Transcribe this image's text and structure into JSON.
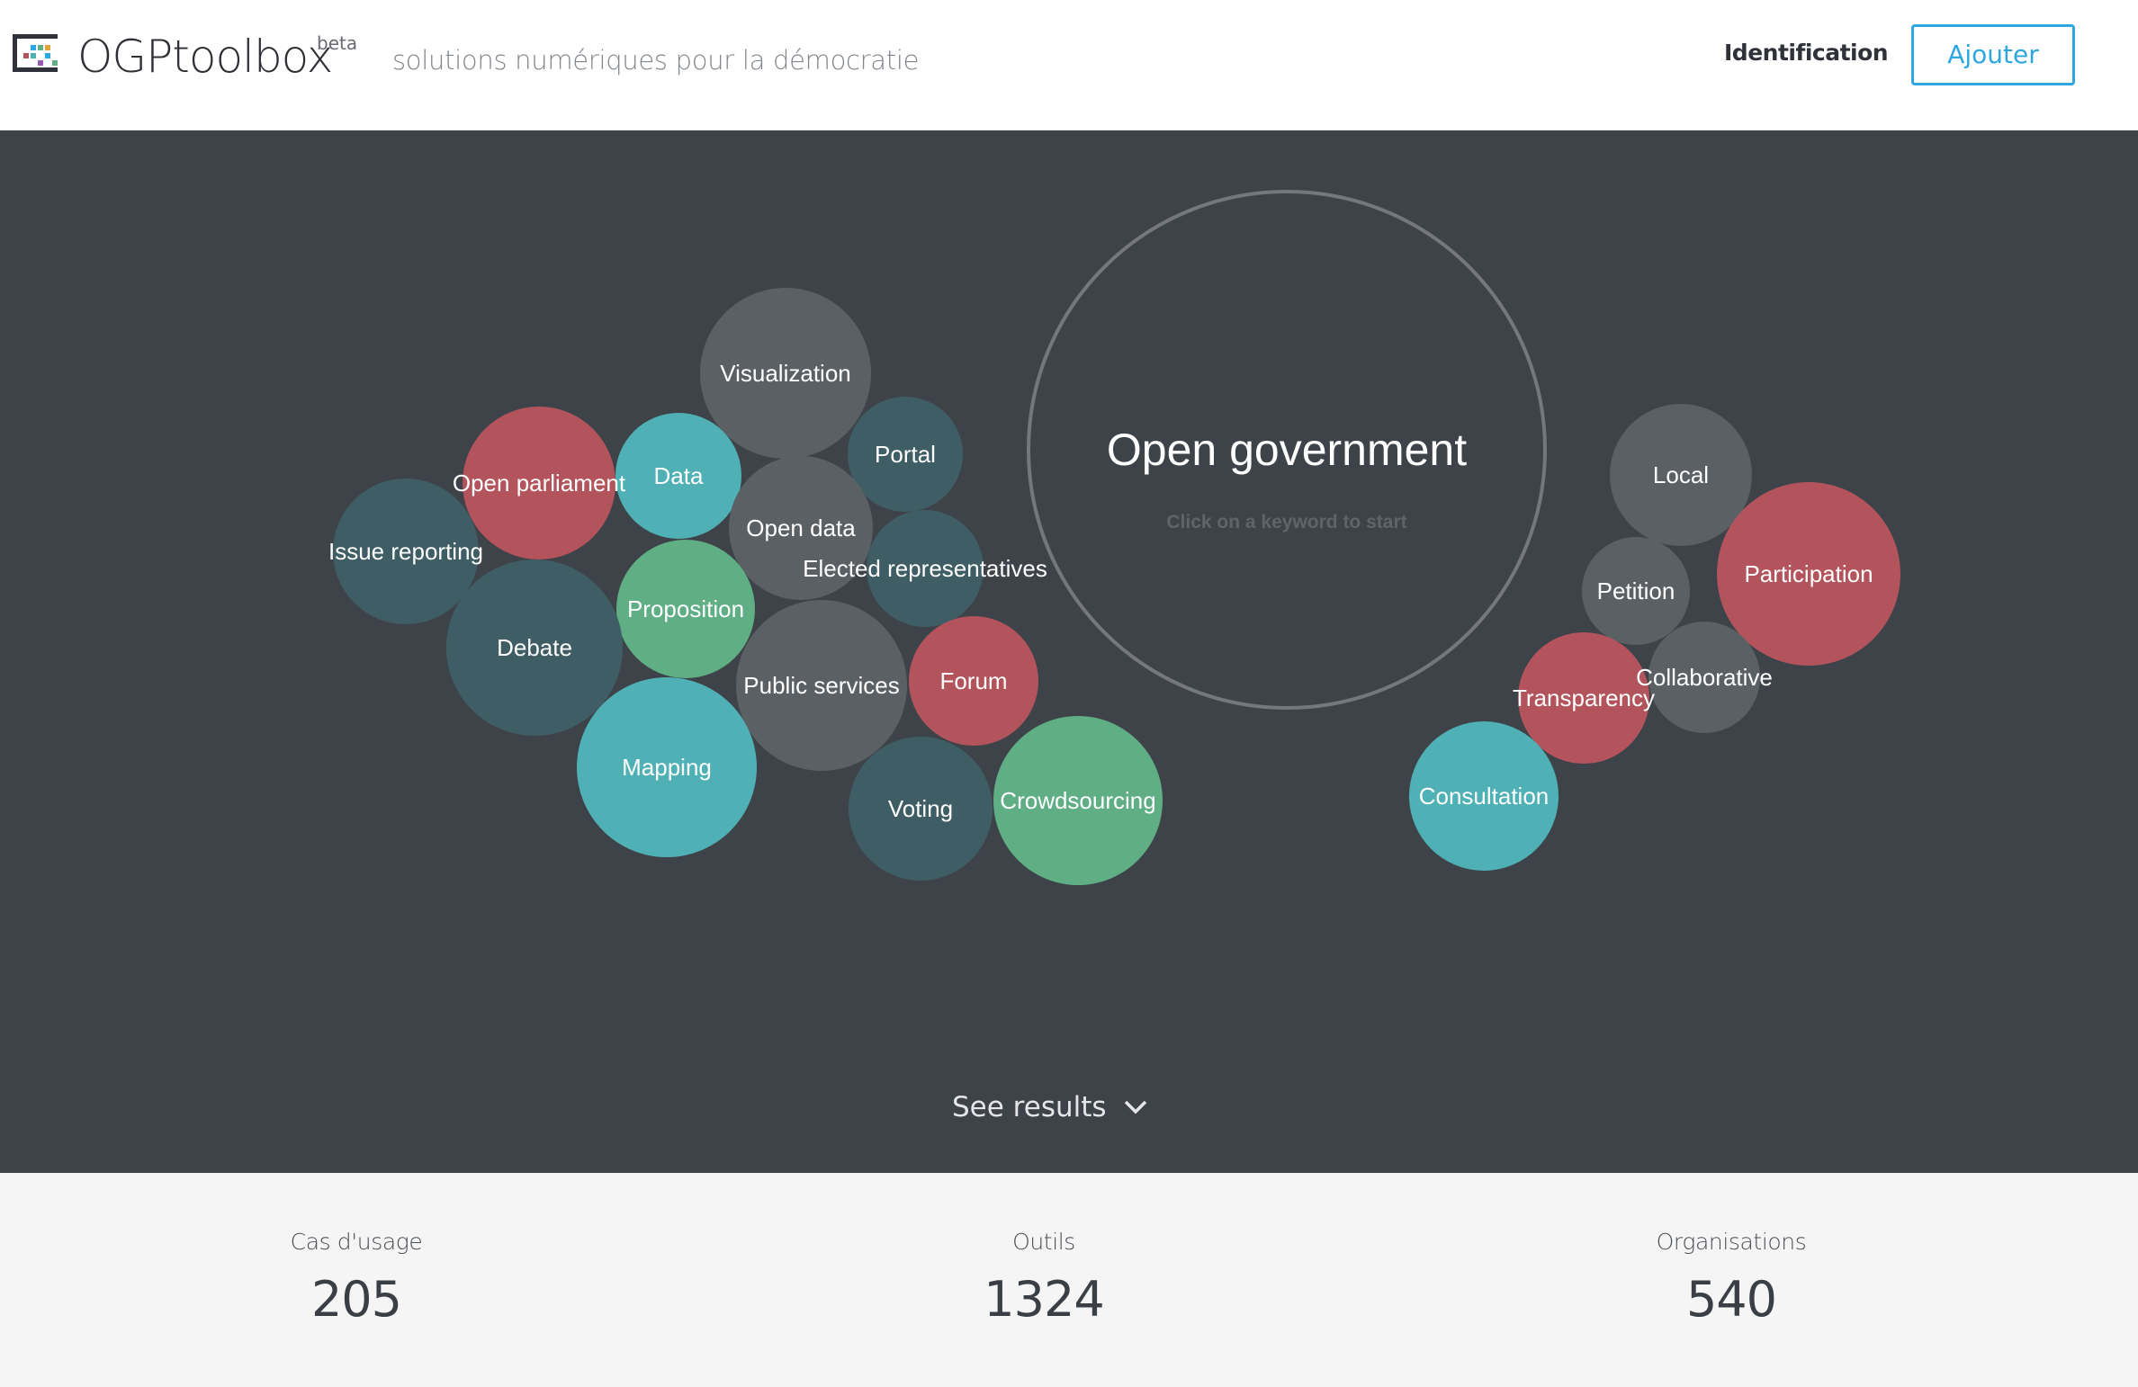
{
  "header": {
    "brand_main": "OGP",
    "brand_tool": "toolbox",
    "beta": "beta",
    "tagline": "solutions numériques pour la démocratie",
    "nav_identification": "Identification",
    "add_button": "Ajouter"
  },
  "hero": {
    "center_title": "Open government",
    "center_hint": "Click on a keyword to start",
    "see_results": "See results",
    "bubbles": [
      {
        "label": "Visualization",
        "color": "#5b6065"
      },
      {
        "label": "Portal",
        "color": "#3f5d64"
      },
      {
        "label": "Open parliament",
        "color": "#b3545c"
      },
      {
        "label": "Data",
        "color": "#4fb1b5"
      },
      {
        "label": "Open data",
        "color": "#5b6065"
      },
      {
        "label": "Issue reporting",
        "color": "#3f5d64"
      },
      {
        "label": "Elected representatives",
        "color": "#3f5d64"
      },
      {
        "label": "Proposition",
        "color": "#5fae84"
      },
      {
        "label": "Debate",
        "color": "#3f5d64"
      },
      {
        "label": "Public services",
        "color": "#5b6065"
      },
      {
        "label": "Forum",
        "color": "#b3545c"
      },
      {
        "label": "Mapping",
        "color": "#4fb1b5"
      },
      {
        "label": "Voting",
        "color": "#3f5d64"
      },
      {
        "label": "Crowdsourcing",
        "color": "#5fae84"
      },
      {
        "label": "Local",
        "color": "#5b6065"
      },
      {
        "label": "Participation",
        "color": "#b3545c"
      },
      {
        "label": "Petition",
        "color": "#5b6065"
      },
      {
        "label": "Collaborative",
        "color": "#5b6065"
      },
      {
        "label": "Transparency",
        "color": "#b3545c"
      },
      {
        "label": "Consultation",
        "color": "#4fb1b5"
      }
    ]
  },
  "stats": [
    {
      "label": "Cas d'usage",
      "value": "205"
    },
    {
      "label": "Outils",
      "value": "1324"
    },
    {
      "label": "Organisations",
      "value": "540"
    }
  ],
  "colors": {
    "accent": "#2ea7e0",
    "hero_bg": "#3e4349",
    "stats_bg": "#f5f5f5"
  }
}
